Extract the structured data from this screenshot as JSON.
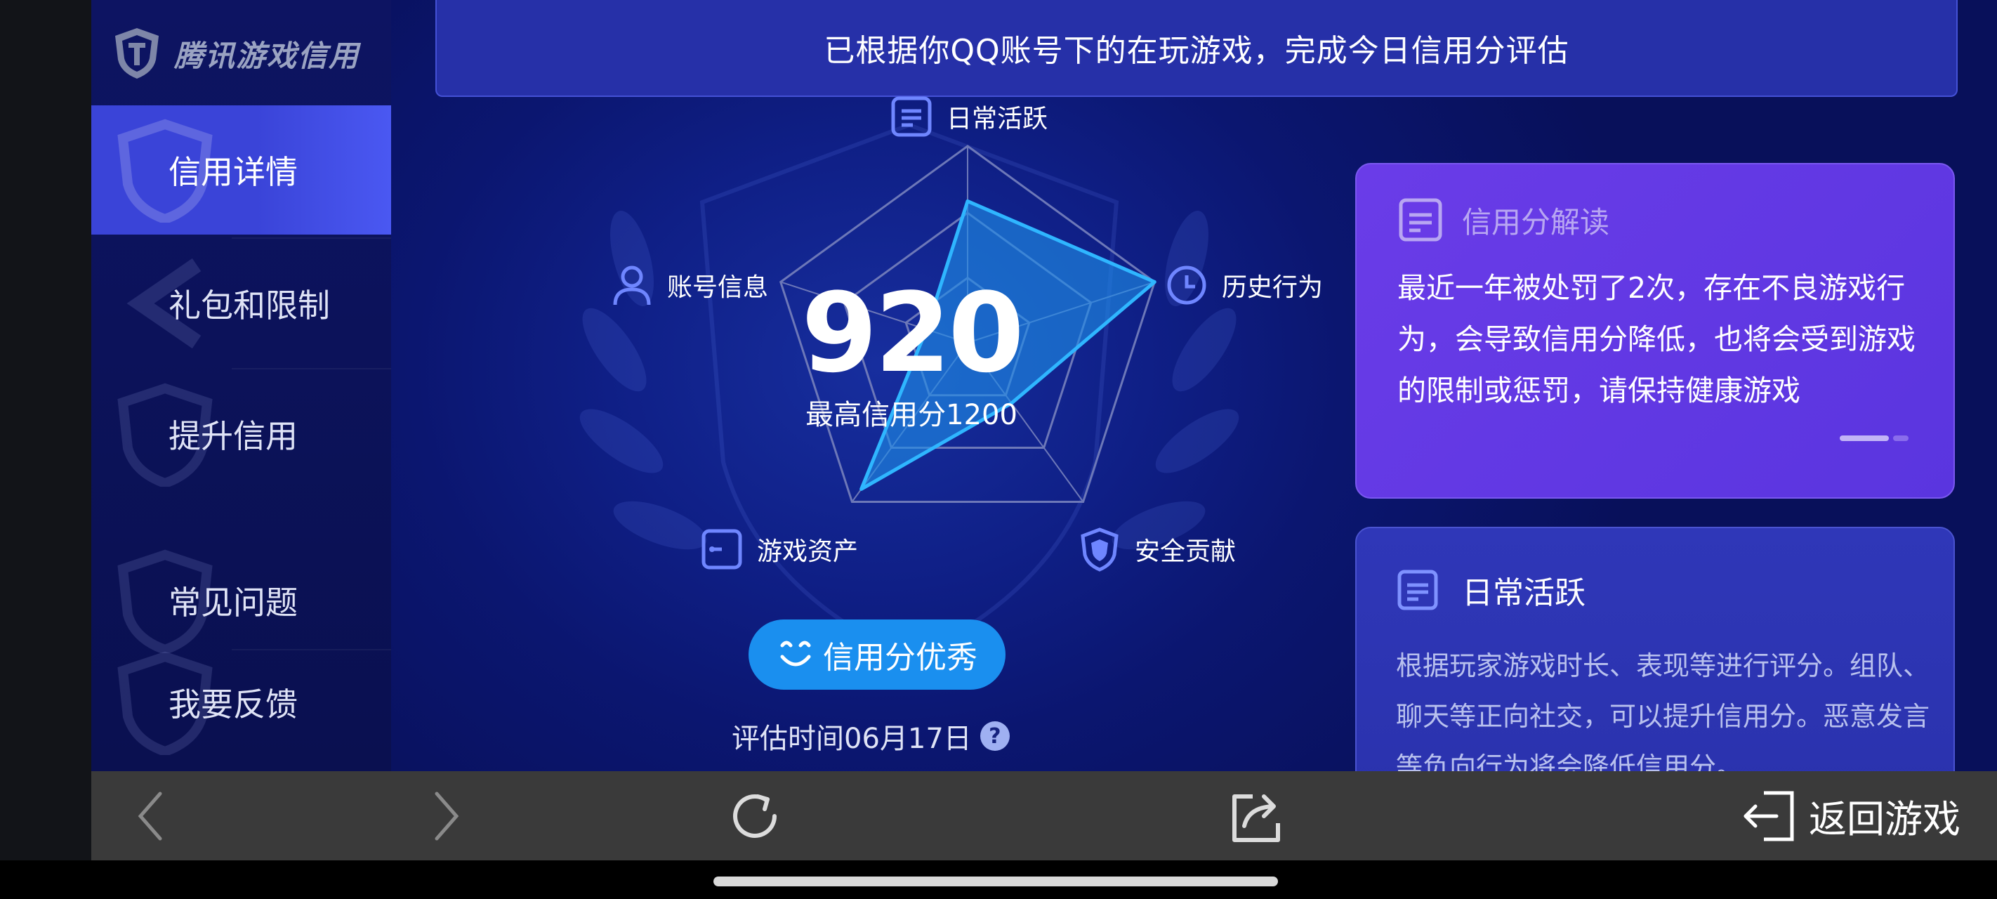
{
  "brand": {
    "title": "腾讯游戏信用",
    "icon": "shield-logo-icon"
  },
  "sidebar": {
    "items": [
      {
        "label": "信用详情",
        "active": true
      },
      {
        "label": "礼包和限制",
        "active": false
      },
      {
        "label": "提升信用",
        "active": false
      },
      {
        "label": "常见问题",
        "active": false
      },
      {
        "label": "我要反馈",
        "active": false
      }
    ]
  },
  "banner": {
    "text": "已根据你QQ账号下的在玩游戏，完成今日信用分评估"
  },
  "radar": {
    "axes": [
      {
        "label": "日常活跃",
        "icon": "document-icon",
        "value": 0.72
      },
      {
        "label": "历史行为",
        "icon": "clock-icon",
        "value": 1.0
      },
      {
        "label": "安全贡献",
        "icon": "shield-icon",
        "value": 0.38
      },
      {
        "label": "游戏资产",
        "icon": "asset-icon",
        "value": 0.92
      },
      {
        "label": "账号信息",
        "icon": "user-icon",
        "value": 0.22
      }
    ],
    "score": "920",
    "max_label": "最高信用分1200"
  },
  "grade": {
    "label": "信用分优秀",
    "icon": "smile-icon"
  },
  "evaluation": {
    "time_text": "评估时间06月17日",
    "help": "?"
  },
  "interpret_card": {
    "title": "信用分解读",
    "icon": "document-icon",
    "body": "最近一年被处罚了2次，存在不良游戏行为，会导致信用分降低，也将会受到游戏的限制或惩罚，请保持健康游戏"
  },
  "daily_card": {
    "title": "日常活跃",
    "icon": "document-icon",
    "body": "根据玩家游戏时长、表现等进行评分。组队、聊天等正向社交，可以提升信用分。恶意发言等负向行为将会降低信用分。"
  },
  "toolbar": {
    "back_icon": "chevron-left-icon",
    "forward_icon": "chevron-right-icon",
    "refresh_icon": "refresh-icon",
    "share_icon": "share-icon",
    "return_label": "返回游戏",
    "return_icon": "exit-icon"
  },
  "colors": {
    "accent": "#1a8fef",
    "radar_fill": "#1f8ee8",
    "card_purple": "#6a3ce8",
    "active_nav": "#3a44d8"
  }
}
